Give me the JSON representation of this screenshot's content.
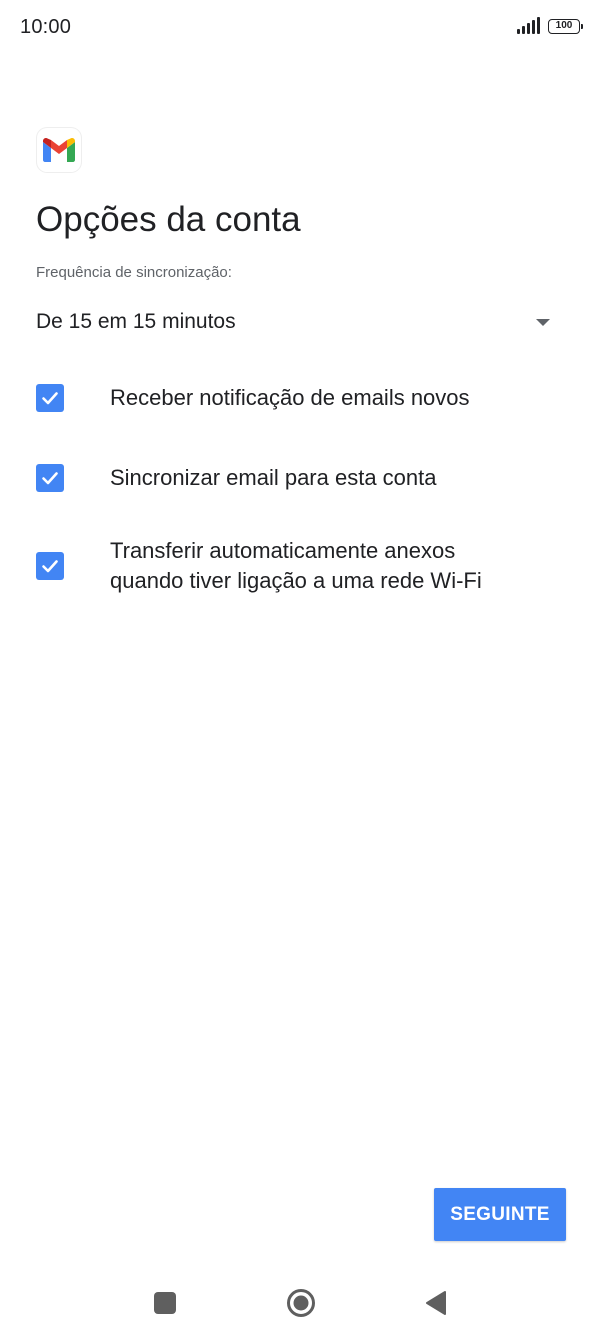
{
  "status_bar": {
    "time": "10:00",
    "battery": "100",
    "signal_icon": "signal-bars-icon",
    "battery_icon": "battery-icon"
  },
  "logo": {
    "icon": "gmail-logo-icon",
    "colors": {
      "red": "#EA4335",
      "blue": "#4285F4",
      "green": "#34A853",
      "yellow": "#FBBC04",
      "dark_red": "#C5221F"
    }
  },
  "page": {
    "title": "Opções da conta"
  },
  "sync": {
    "label": "Frequência de sincronização:",
    "selected": "De 15 em 15 minutos",
    "icon": "dropdown-arrow-icon"
  },
  "options": [
    {
      "label": "Receber notificação de emails novos",
      "checked": true
    },
    {
      "label": "Sincronizar email para esta conta",
      "checked": true
    },
    {
      "label_line1": "Transferir automaticamente anexos",
      "label_line2": "quando tiver ligação a uma rede Wi-Fi",
      "checked": true
    }
  ],
  "actions": {
    "next_label": "SEGUINTE"
  },
  "nav_bar": {
    "recents_icon": "square-recents-icon",
    "home_icon": "circle-home-icon",
    "back_icon": "triangle-back-icon"
  },
  "colors": {
    "accent": "#4285F4",
    "text_primary": "#202124",
    "text_secondary": "#5F6368"
  }
}
